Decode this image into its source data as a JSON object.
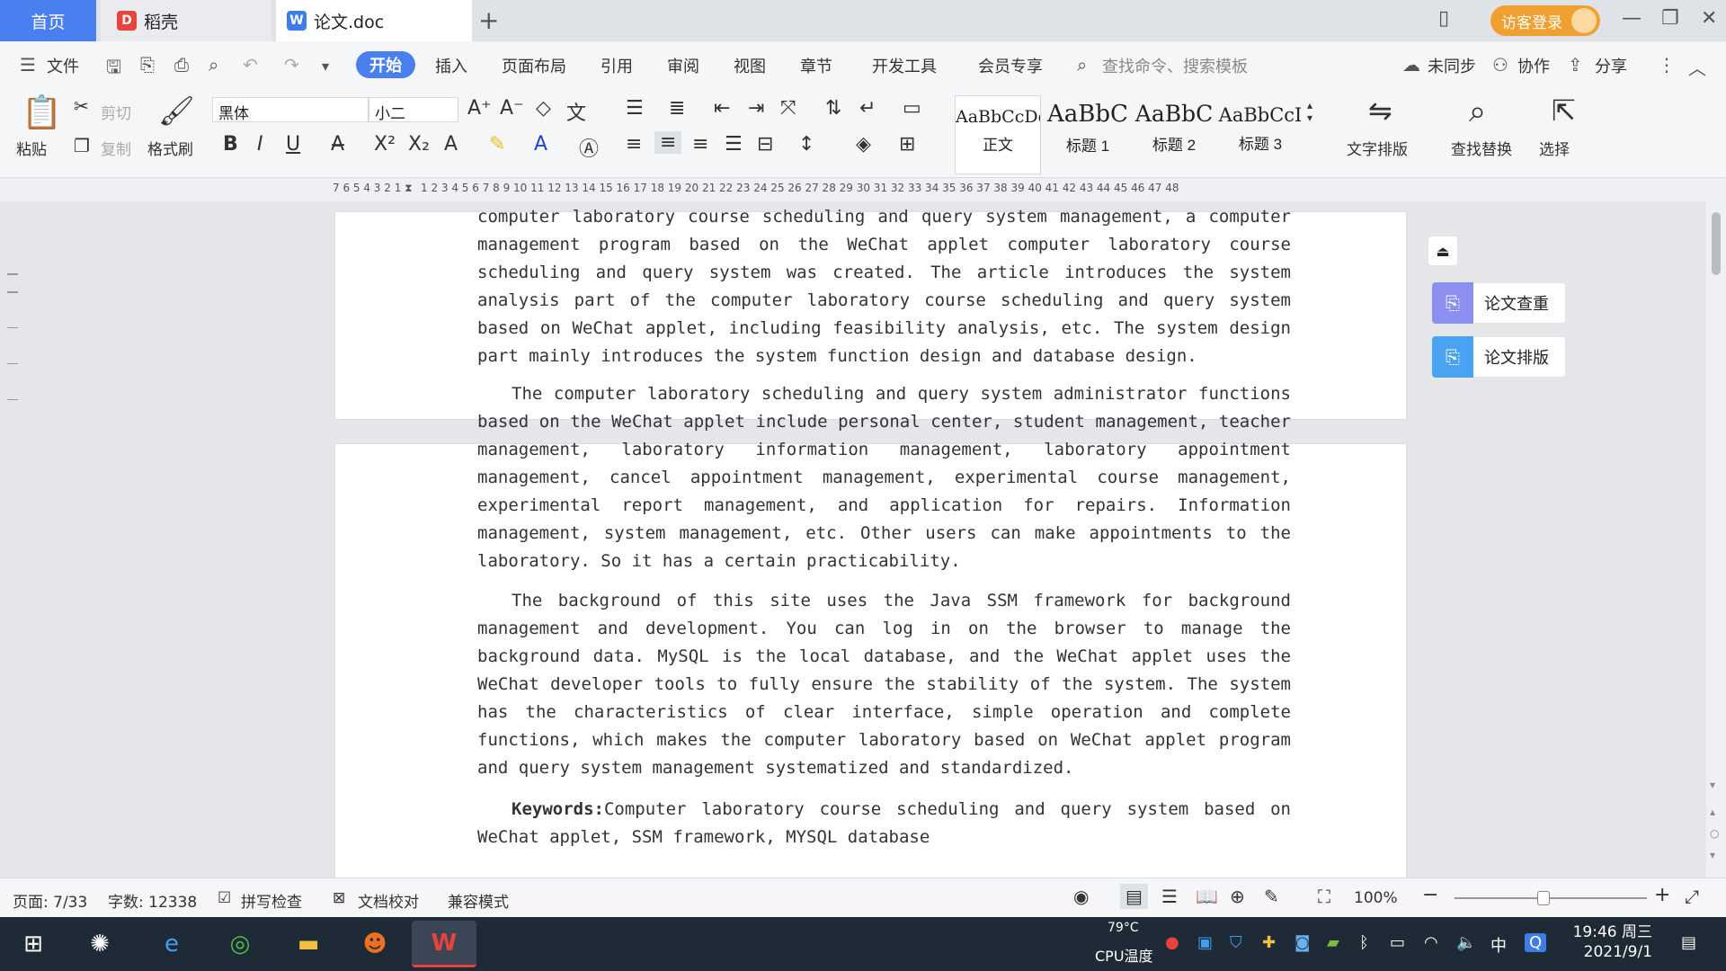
{
  "tabs": {
    "home": "首页",
    "daoke": "稻壳",
    "doc": "论文.doc",
    "plus": "+"
  },
  "account": {
    "login": "访客登录"
  },
  "menu": {
    "file": "文件",
    "items": [
      "开始",
      "插入",
      "页面布局",
      "引用",
      "审阅",
      "视图",
      "章节",
      "开发工具",
      "会员专享"
    ],
    "search": "查找命令、搜索模板",
    "sync": "未同步",
    "collab": "协作",
    "share": "分享"
  },
  "ribbon": {
    "paste": "粘贴",
    "cut": "剪切",
    "copy": "复制",
    "format_painter": "格式刷",
    "font_name": "黑体",
    "font_size": "小二",
    "styles": [
      {
        "preview": "AaBbCcDd",
        "label": "正文"
      },
      {
        "preview": "AaBbC",
        "label": "标题 1"
      },
      {
        "preview": "AaBbC",
        "label": "标题 2"
      },
      {
        "preview": "AaBbCcI",
        "label": "标题 3"
      }
    ],
    "text_layout": "文字排版",
    "find_replace": "查找替换",
    "select": "选择"
  },
  "ruler": {
    "left_ticks": "7  6  5  4  3  2  1",
    "right_ticks": "1  2  3  4  5  6  7  8  9  10 11 12 13 14 15 16 17 18 19 20 21 22 23 24 25 26 27 28 29 30 31 32 33 34 35 36 37 38 39 40 41 42 43 44 45 46 47 48"
  },
  "document": {
    "p1": "computer laboratory course scheduling and query system management, a computer management program based on the WeChat applet computer laboratory course scheduling and query system was created. The article introduces the system analysis part of the computer laboratory course scheduling and query system based on WeChat applet, including feasibility analysis, etc. The system design part mainly introduces the system function design and database design.",
    "p2": "The computer laboratory scheduling and query system administrator functions based on the WeChat applet include personal center, student management, teacher management, laboratory information management, laboratory appointment management, cancel appointment management, experimental course management, experimental report management, and application for repairs. Information management, system management, etc. Other users can make appointments to the laboratory. So it has a certain practicability.",
    "p3": "The background of this site uses the Java SSM framework for background management and development. You can log in on the browser to manage the background data. MySQL is the local database, and the WeChat applet uses the WeChat developer tools to fully ensure the stability of the system. The system has the characteristics of clear interface, simple operation and complete functions, which makes the computer laboratory based on WeChat applet program and query system management systematized and standardized.",
    "keywords_label": "Keywords:",
    "keywords": "Computer laboratory course scheduling and query system based on WeChat applet, SSM framework, MYSQL database"
  },
  "side_panel": {
    "check": "论文查重",
    "layout": "论文排版"
  },
  "status": {
    "page": "页面: 7/33",
    "words": "字数: 12338",
    "spell": "拼写检查",
    "proof": "文档校对",
    "compat": "兼容模式",
    "zoom": "100%"
  },
  "taskbar": {
    "cpu_temp": "79°C",
    "cpu_label": "CPU温度",
    "ime": "中",
    "time": "19:46 周三",
    "date": "2021/9/1"
  },
  "colors": {
    "accent": "#4a7ff0",
    "login": "#f0a030",
    "side_check": "#8a8ff0",
    "side_layout": "#4aa3f0"
  }
}
